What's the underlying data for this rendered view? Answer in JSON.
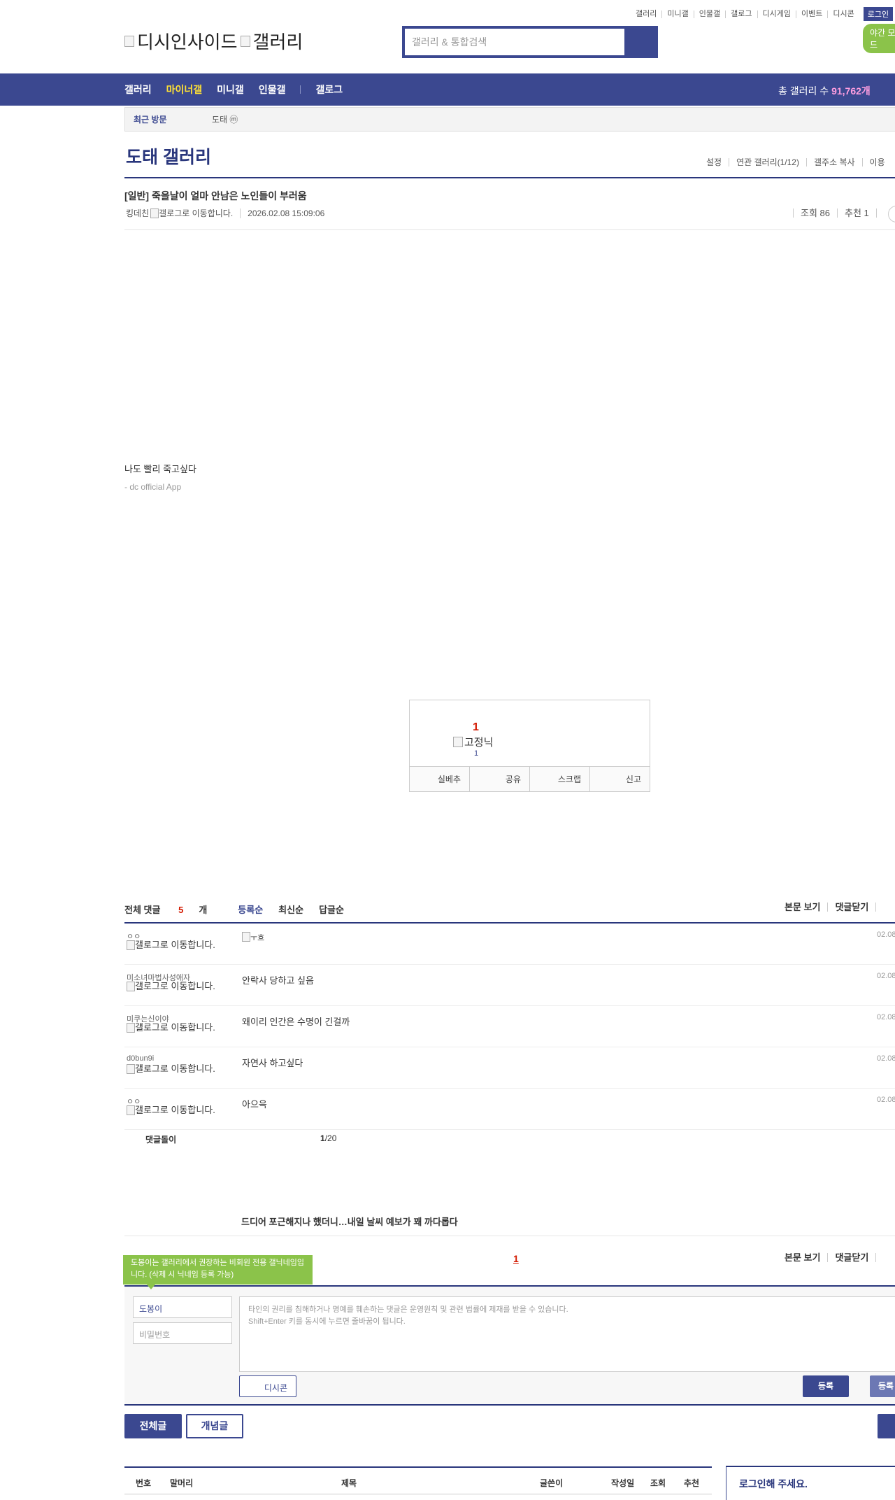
{
  "utility_nav": {
    "items": [
      "갤러리",
      "미니갤",
      "인물갤",
      "갤로그",
      "디시게임",
      "이벤트",
      "디시콘"
    ],
    "login": "로그인",
    "night_mode": "야간 모드"
  },
  "logo": {
    "brand": "디시인사이드",
    "section": "갤러리"
  },
  "search": {
    "placeholder": "갤러리 & 통합검색"
  },
  "main_nav": {
    "items": [
      "갤러리",
      "마이너갤",
      "미니갤",
      "인물갤"
    ],
    "active": "마이너갤",
    "gallog": "갤로그",
    "total_label": "총 갤러리 수 ",
    "total_value": "91,762개"
  },
  "recent": {
    "label": "최근 방문",
    "item": "도태 ⓜ"
  },
  "gallery": {
    "title": "도태 갤러리",
    "menu": [
      "설정",
      "연관 갤러리(1/12)",
      "갤주소 복사",
      "이용"
    ]
  },
  "post": {
    "title": "[일반] 죽을날이 얼마 안남은 노인들이 부러움",
    "author": "킹데친",
    "gallog_alt": "갤로그로 이동합니다.",
    "date": "2026.02.08 15:09:06",
    "views": "조회 86",
    "recommend": "추천 1",
    "body": "나도 빨리 죽고싶다",
    "signature": "- dc official App"
  },
  "recommend_box": {
    "count": "1",
    "nick": "고정닉",
    "sub_count": "1",
    "actions": [
      "실베추",
      "공유",
      "스크랩",
      "신고"
    ]
  },
  "comments_header": {
    "total_prefix": "전체 댓글 ",
    "total_count": "5",
    "total_suffix": "개",
    "sorts": [
      "등록순",
      "최신순",
      "답글순"
    ],
    "right": [
      "본문 보기",
      "댓글닫기",
      ""
    ]
  },
  "comments": [
    {
      "nick": "ㅇㅇ",
      "gallog": "갤로그로 이동합니다.",
      "text": "ㅜ흐",
      "date": "02.08"
    },
    {
      "nick": "미소녀마법사성애자",
      "gallog": "갤로그로 이동합니다.",
      "text": "안락사 당하고 싶음",
      "date": "02.08"
    },
    {
      "nick": "미쿠는신이야",
      "gallog": "갤로그로 이동합니다.",
      "text": "왜이리 인간은 수명이 긴걸까",
      "date": "02.08"
    },
    {
      "nick": "d0bun9i",
      "gallog": "갤로그로 이동합니다.",
      "text": "자연사 하고싶다",
      "date": "02.08"
    },
    {
      "nick": "ㅇㅇ",
      "gallog": "갤로그로 이동합니다.",
      "text": "아으윽",
      "date": "02.08"
    }
  ],
  "reply_bar": {
    "label": "댓글돌이",
    "page_current": "1",
    "page_total": "/20"
  },
  "next_post": "드디어 포근해지나 했더니…내일 날씨 예보가 꽤 까다롭다",
  "pagination": {
    "current": "1"
  },
  "comments_footer": {
    "right": [
      "본문 보기",
      "댓글닫기"
    ]
  },
  "write": {
    "tooltip": "도봉이는 갤러리에서 권장하는 비회원 전용 갤닉네임입니다. (삭제 시 닉네임 등록 가능)",
    "nick_value": "도봉이",
    "password_placeholder": "비밀번호",
    "textarea_line1": "타인의 권리를 침해하거나 명예를 훼손하는 댓글은 운영원칙 및 관련 법률에 제재를 받을 수 있습니다.",
    "textarea_line2": "Shift+Enter 키를 동시에 누르면 줄바꿈이 됩니다.",
    "dccon": "디시콘",
    "submit": "등록",
    "submit2": "등록"
  },
  "list_tabs": {
    "all": "전체글",
    "concept": "개념글"
  },
  "list_header": [
    "번호",
    "말머리",
    "제목",
    "글쓴이",
    "작성일",
    "조회",
    "추천"
  ],
  "login_box": {
    "text": "로그인해 주세요."
  },
  "colors": {
    "primary": "#3b4890",
    "dark": "#29367c",
    "accent_red": "#d31900",
    "accent_green": "#8bc34a",
    "nav_active": "#ffe135"
  }
}
